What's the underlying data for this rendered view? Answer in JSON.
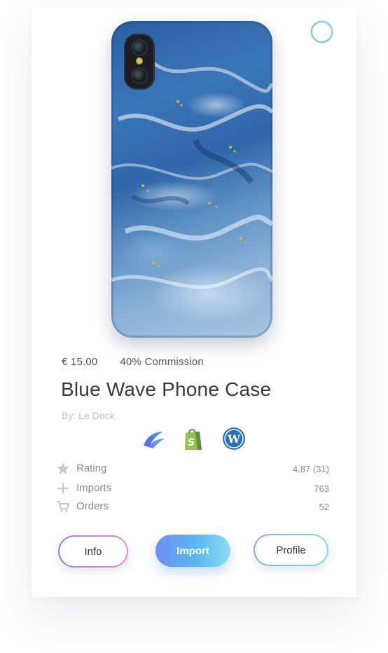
{
  "product": {
    "price": "€ 15.00",
    "commission": "40% Commission",
    "title": "Blue Wave Phone Case",
    "byline": "By: Le Dock"
  },
  "platforms": [
    {
      "name": "platform-a",
      "icon": "swoosh-logo-icon",
      "color": "#3d7bea"
    },
    {
      "name": "shopify",
      "icon": "shopify-bag-icon",
      "color": "#95bf47"
    },
    {
      "name": "wordpress",
      "icon": "wordpress-logo-icon",
      "color": "#2a72b8"
    }
  ],
  "stats": [
    {
      "icon": "star-icon",
      "label": "Rating",
      "value": "4.87 (31)"
    },
    {
      "icon": "plus-icon",
      "label": "Imports",
      "value": "763"
    },
    {
      "icon": "cart-icon",
      "label": "Orders",
      "value": "52"
    }
  ],
  "actions": {
    "info_label": "Info",
    "import_label": "Import",
    "profile_label": "Profile"
  },
  "colors": {
    "accent_gradient_start": "#6b8ff0",
    "accent_gradient_end": "#8fdcf3",
    "title_text": "#3a3a3a",
    "muted_text": "#8a8a8a"
  }
}
